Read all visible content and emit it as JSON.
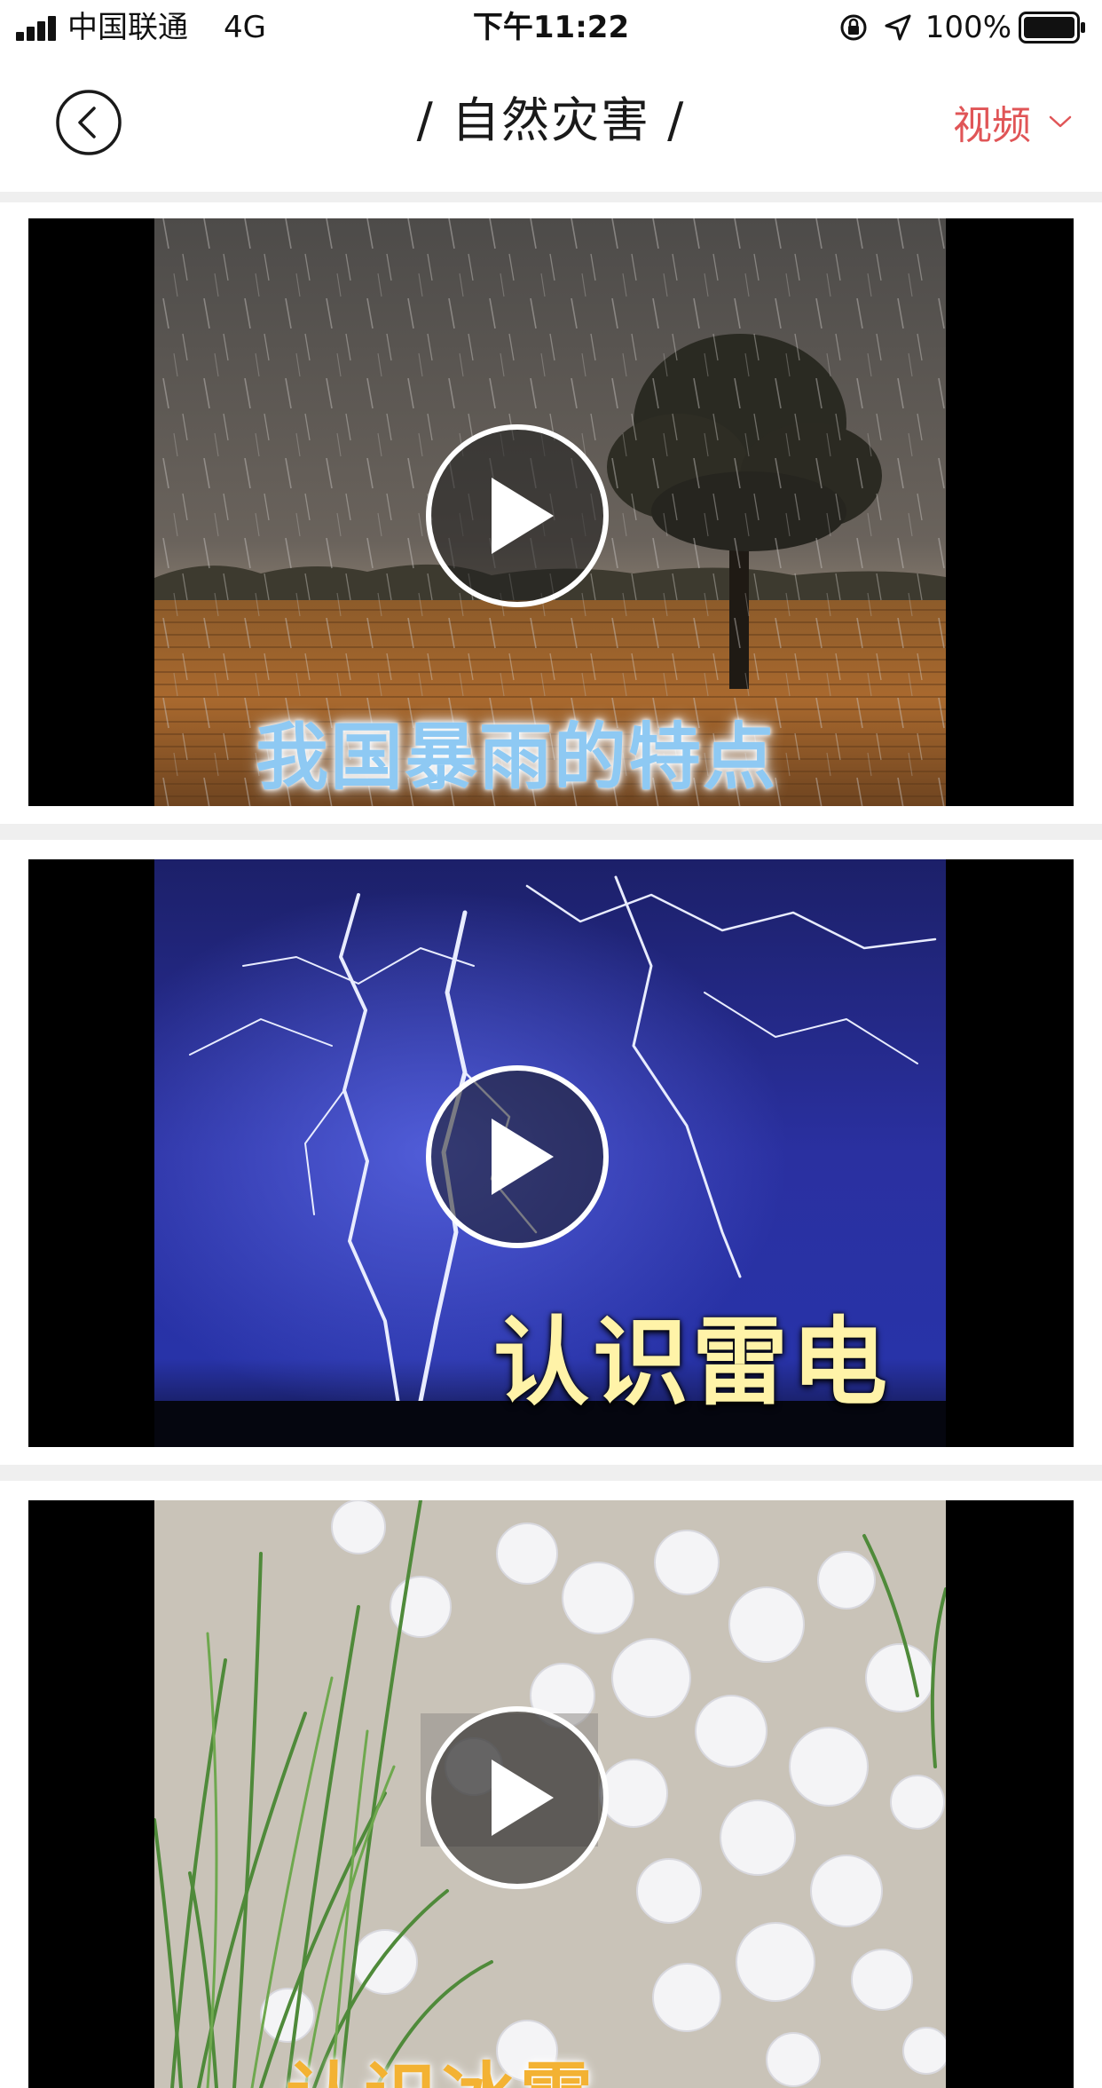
{
  "status_bar": {
    "carrier": "中国联通",
    "network": "4G",
    "time": "下午11:22",
    "battery_percent": "100%",
    "icons": [
      "signal-bars-icon",
      "orientation-lock-icon",
      "location-arrow-icon",
      "battery-icon"
    ]
  },
  "nav": {
    "title": "/ 自然灾害 /",
    "filter_label": "视频",
    "back_icon": "back-arrow-icon",
    "filter_icon": "chevron-down-icon",
    "accent_color": "#e05557"
  },
  "videos": [
    {
      "caption": "我国暴雨的特点",
      "thumbnail": "rainstorm-field-tree-image",
      "play_icon": "play-icon"
    },
    {
      "caption": "认识雷电",
      "thumbnail": "lightning-night-sky-image",
      "play_icon": "play-icon"
    },
    {
      "caption": "认识冰雹",
      "thumbnail": "hailstones-grass-image",
      "play_icon": "play-icon"
    }
  ]
}
